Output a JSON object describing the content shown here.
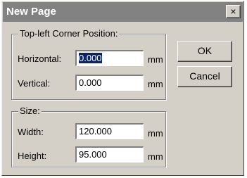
{
  "dialog": {
    "title": "New Page",
    "close_glyph": "×"
  },
  "position_group": {
    "legend": "Top-left Corner Position:",
    "horizontal": {
      "label": "Horizontal:",
      "value": "0.000",
      "unit": "mm"
    },
    "vertical": {
      "label": "Vertical:",
      "value": "0.000",
      "unit": "mm"
    }
  },
  "size_group": {
    "legend": "Size:",
    "width": {
      "label": "Width:",
      "value": "120.000",
      "unit": "mm"
    },
    "height": {
      "label": "Height:",
      "value": "95.000",
      "unit": "mm"
    }
  },
  "buttons": {
    "ok": "OK",
    "cancel": "Cancel"
  },
  "colors": {
    "dialog_face": "#d4d0c8",
    "titlebar": "#828282",
    "selection": "#0a246a"
  }
}
